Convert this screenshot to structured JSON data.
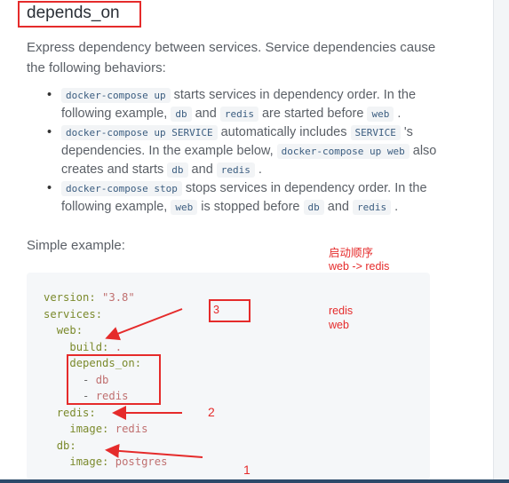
{
  "heading": "depends_on",
  "intro": "Express dependency between services. Service dependencies cause the following behaviors:",
  "bullets": [
    {
      "code1": "docker-compose up",
      "t1": " starts services in dependency order. In the following example, ",
      "code2": "db",
      "t2": " and ",
      "code3": "redis",
      "t3": " are started before ",
      "code4": "web",
      "t4": " ."
    },
    {
      "code1": "docker-compose up SERVICE",
      "t1": " automatically includes ",
      "code2": "SERVICE",
      "t2": " 's dependencies. In the example below, ",
      "code3": "docker-compose up web",
      "t3": " also creates and starts ",
      "code4": "db",
      "t4": " and ",
      "code5": "redis",
      "t5": " ."
    },
    {
      "code1": "docker-compose stop",
      "t1": " stops services in dependency order. In the following example, ",
      "code2": "web",
      "t2": " is stopped before ",
      "code3": "db",
      "t3": " and ",
      "code4": "redis",
      "t4": " ."
    }
  ],
  "simple_label": "Simple example:",
  "code": {
    "version_key": "version:",
    "version_val": "\"3.8\"",
    "services": "services:",
    "web": "web:",
    "build": "build:",
    "build_val": ".",
    "depends_on": "depends_on:",
    "dep1": "db",
    "dep2": "redis",
    "redis": "redis:",
    "image": "image:",
    "redis_img": "redis",
    "db": "db:",
    "db_img": "postgres"
  },
  "annotations": {
    "order_title": "启动顺序",
    "order": "web -> redis",
    "stop1": "redis",
    "stop2": "web",
    "n3": "3",
    "n2": "2",
    "n1": "1"
  },
  "colors": {
    "annotation": "#e52b2b"
  }
}
